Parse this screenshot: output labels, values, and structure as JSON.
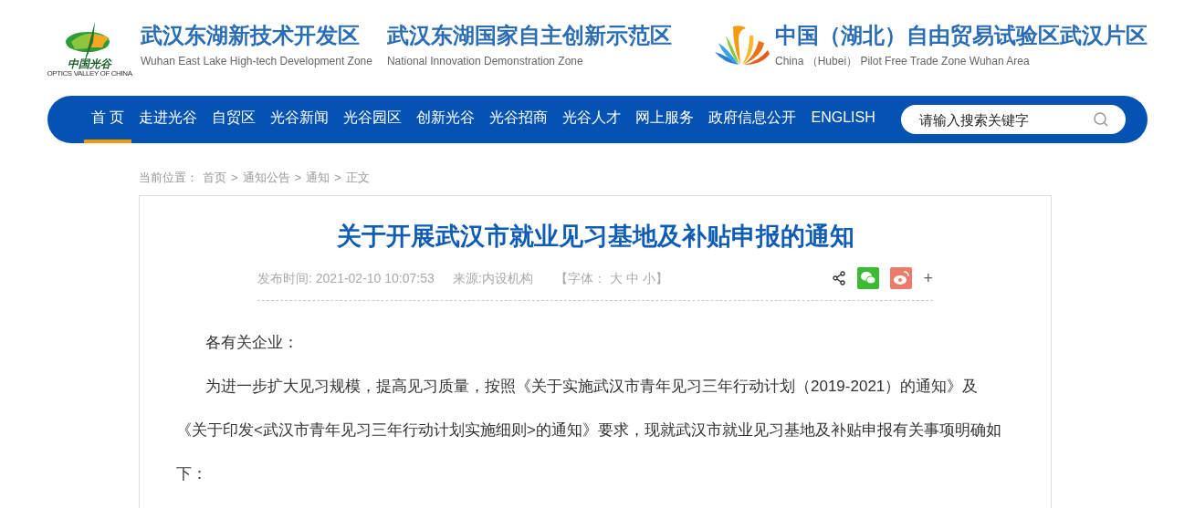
{
  "header": {
    "logo_text": "中国光谷",
    "logo_subtext": "OPTICS VALLEY OF CHINA",
    "zones": [
      {
        "title": "武汉东湖新技术开发区",
        "subtitle": "Wuhan East Lake High-tech Development Zone"
      },
      {
        "title": "武汉东湖国家自主创新示范区",
        "subtitle": "National Innovation Demonstration Zone"
      }
    ],
    "ftz": {
      "title": "中国（湖北）自由贸易试验区武汉片区",
      "subtitle": "China （Hubei） Pilot Free Trade Zone Wuhan Area"
    }
  },
  "nav": {
    "items": [
      {
        "label": "首 页",
        "selected": true
      },
      {
        "label": "走进光谷",
        "selected": false
      },
      {
        "label": "自贸区",
        "selected": false
      },
      {
        "label": "光谷新闻",
        "selected": false
      },
      {
        "label": "光谷园区",
        "selected": false
      },
      {
        "label": "创新光谷",
        "selected": false
      },
      {
        "label": "光谷招商",
        "selected": false
      },
      {
        "label": "光谷人才",
        "selected": false
      },
      {
        "label": "网上服务",
        "selected": false
      },
      {
        "label": "政府信息公开",
        "selected": false
      },
      {
        "label": "ENGLISH",
        "selected": false
      }
    ],
    "search": {
      "placeholder": "请输入搜索关键字"
    }
  },
  "breadcrumb": {
    "label": "当前位置：",
    "items": [
      "首页",
      "通知公告",
      "通知",
      "正文"
    ],
    "separator": ">"
  },
  "article": {
    "title": "关于开展武汉市就业见习基地及补贴申报的通知",
    "published": "发布时间: 2021-02-10 10:07:53",
    "source": "来源:内设机构",
    "font_size": {
      "open": "【字体：",
      "options": [
        "大",
        "中",
        "小"
      ],
      "close": "】"
    },
    "share_more": "+",
    "paragraphs": [
      "各有关企业：",
      "为进一步扩大见习规模，提高见习质量，按照《关于实施武汉市青年见习三年行动计划（2019-2021）的通知》及《关于印发<武汉市青年见习三年行动计划实施细则>的通知》要求，现就武汉市就业见习基地及补贴申报有关事项明确如下："
    ]
  }
}
